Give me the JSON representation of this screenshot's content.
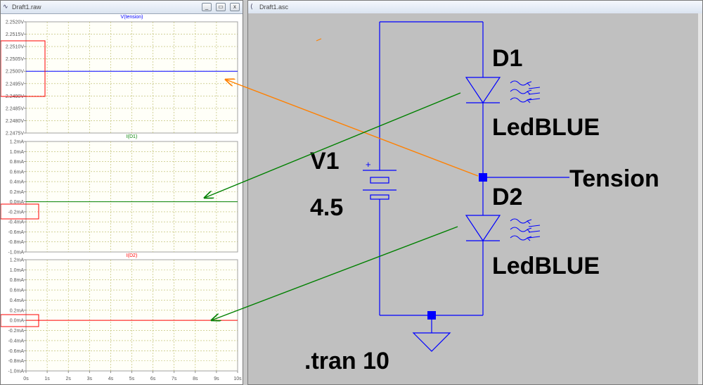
{
  "waveform_window": {
    "title": "Draft1.raw",
    "buttons": [
      "_",
      "▭",
      "x"
    ],
    "x_ticks": [
      "0s",
      "1s",
      "2s",
      "3s",
      "4s",
      "5s",
      "6s",
      "7s",
      "8s",
      "9s",
      "10s"
    ],
    "panes": [
      {
        "trace": "V(tension)",
        "color": "#0000ff",
        "ticks": [
          "2.2520V",
          "2.2515V",
          "2.2510V",
          "2.2505V",
          "2.2500V",
          "2.2495V",
          "2.2490V",
          "2.2485V",
          "2.2480V",
          "2.2475V"
        ],
        "trace_level": "2.2500V"
      },
      {
        "trace": "I(D1)",
        "color": "#008000",
        "ticks": [
          "1.2mA",
          "1.0mA",
          "0.8mA",
          "0.6mA",
          "0.4mA",
          "0.2mA",
          "0.0mA",
          "-0.2mA",
          "-0.4mA",
          "-0.6mA",
          "-0.8mA",
          "-1.0mA"
        ],
        "trace_level": "0.0mA"
      },
      {
        "trace": "I(D2)",
        "color": "#ff0000",
        "ticks": [
          "1.2mA",
          "1.0mA",
          "0.8mA",
          "0.6mA",
          "0.4mA",
          "0.2mA",
          "0.0mA",
          "-0.2mA",
          "-0.4mA",
          "-0.6mA",
          "-0.8mA",
          "-1.0mA"
        ],
        "trace_level": "0.0mA"
      }
    ]
  },
  "schematic_window": {
    "title": "Draft1.asc",
    "labels": {
      "d1_name": "D1",
      "d1_model": "LedBLUE",
      "d2_name": "D2",
      "d2_model": "LedBLUE",
      "v1_name": "V1",
      "v1_value": "4.5",
      "net_label": "Tension",
      "plus_sign": "+",
      "directive": ".tran 10"
    }
  },
  "colors": {
    "wire": "#0000ff",
    "junction": "#0000ff",
    "annotation_orange": "#ff8000",
    "annotation_green": "#008000",
    "highlight_box": "#ff0000"
  }
}
